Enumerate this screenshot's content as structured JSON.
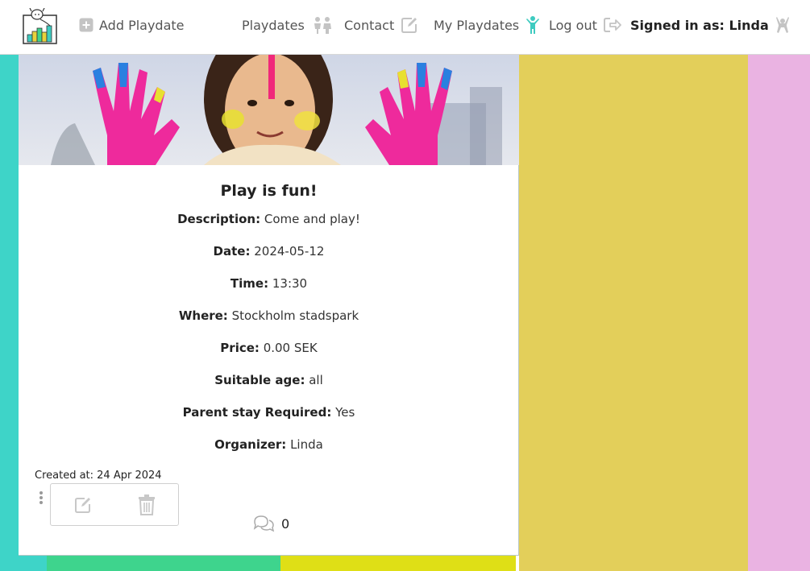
{
  "navbar": {
    "add_playdate": "Add Playdate",
    "playdates": "Playdates",
    "contact": "Contact",
    "my_playdates": "My Playdates",
    "log_out": "Log out",
    "signed_in_as": "Signed in as: Linda"
  },
  "playdate": {
    "title": "Play is fun!",
    "fields": [
      {
        "label": "Description:",
        "value": "Come and play!"
      },
      {
        "label": "Date:",
        "value": "2024-05-12"
      },
      {
        "label": "Time:",
        "value": "13:30"
      },
      {
        "label": "Where:",
        "value": "Stockholm stadspark"
      },
      {
        "label": "Price:",
        "value": "0.00 SEK"
      },
      {
        "label": "Suitable age:",
        "value": "all"
      },
      {
        "label": "Parent stay Required:",
        "value": "Yes"
      },
      {
        "label": "Organizer:",
        "value": "Linda"
      }
    ],
    "created_at": "Created at: 24 Apr 2024",
    "comment_count": "0"
  },
  "colors": {
    "teal": "#3ed4c8",
    "yellow": "#e3cf5a",
    "pink": "#eab3e2",
    "green": "#3ed48d",
    "lime": "#dfdf16",
    "icon_teal": "#3ecbc0"
  }
}
